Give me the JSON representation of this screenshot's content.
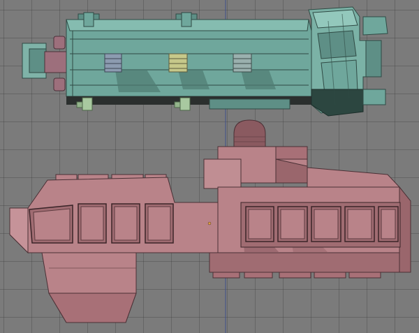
{
  "viewport": {
    "background": "#7b7b7b",
    "grid_color": "#5c5c5c",
    "axis_color": "#3f4f8a"
  },
  "models": [
    {
      "name": "teal-vehicle-top-view",
      "color": "#6b9f95",
      "shadow": "#4a7068",
      "dark": "#2c4640"
    },
    {
      "name": "pink-vehicle-side-view",
      "color": "#b57e84",
      "shadow": "#8a5a60",
      "dark": "#5c3a3e"
    }
  ],
  "panel_colors": [
    "#8c9bb0",
    "#c6c88a",
    "#9ab0ae"
  ]
}
